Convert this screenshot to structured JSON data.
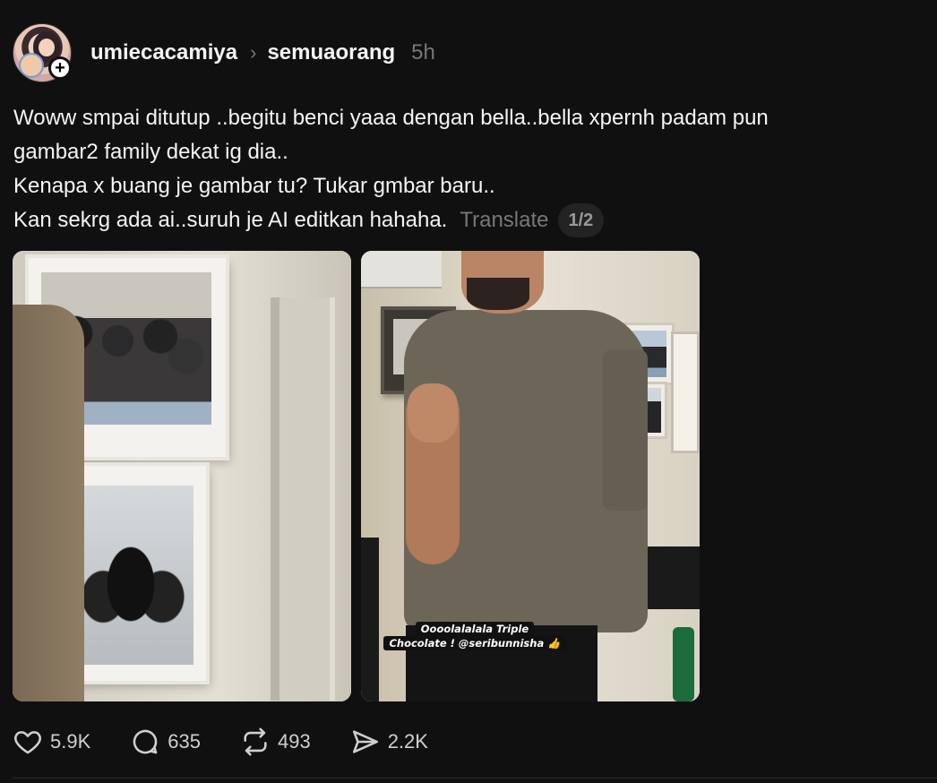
{
  "post": {
    "username": "umiecacamiya",
    "community": "semuaorang",
    "time": "5h",
    "body_lines": [
      "Woww smpai ditutup ..begitu benci yaaa dengan bella..bella xpernh padam pun",
      "gambar2 family dekat ig dia..",
      "Kenapa x buang je gambar tu? Tukar gmbar baru..",
      "Kan sekrg ada ai..suruh je AI editkan hahaha."
    ],
    "translate_label": "Translate",
    "page_indicator": "1/2",
    "image2_caption_line1": "Oooolalalala Triple",
    "image2_caption_line2": "Chocolate ! @seribunnisha 👍"
  },
  "actions": {
    "likes": "5.9K",
    "replies": "635",
    "reposts": "493",
    "shares": "2.2K"
  },
  "icons": {
    "like": "heart-icon",
    "reply": "comment-icon",
    "repost": "repost-icon",
    "share": "send-icon",
    "follow": "plus-icon"
  }
}
